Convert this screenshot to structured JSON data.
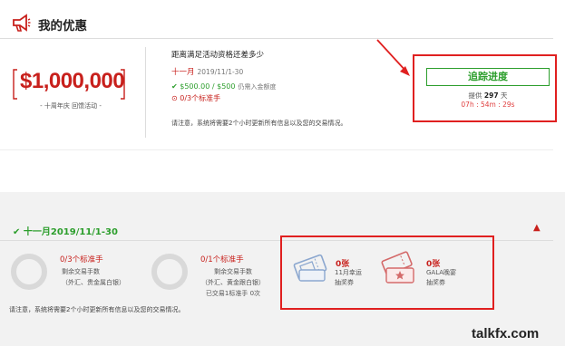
{
  "header": {
    "title": "我的优惠"
  },
  "promo": {
    "amount": "$1,000,000",
    "subtitle": "- 十周年庆 回馈活动 -"
  },
  "detail": {
    "question": "距离满足活动资格还差多少",
    "month": "十一月",
    "date_range": "2019/11/1-30",
    "amount_progress": "$500.00 / $500",
    "amount_note": "仍需入金额度",
    "lots_progress": "0/3个标准手",
    "notice": "请注意，系统将需要2个小时更新所有信息以及您的交易情况。"
  },
  "tracking": {
    "button_label": "追踪进度",
    "remain_prefix": "提供",
    "remain_days": "297",
    "remain_suffix": "天",
    "countdown": "07h : 54m : 29s"
  },
  "section": {
    "title": "十一月2019/11/1-30",
    "lots1_title": "0/3个标准手",
    "lots1_line1": "剩余交易手数",
    "lots1_line2": "（外汇、贵金属白银）",
    "lots2_title": "0/1个标准手",
    "lots2_line1": "剩余交易手数",
    "lots2_line2": "（外汇、黄金跟白银）",
    "lots2_line3": "已交易1标准手 0次",
    "ticket1_count": "0张",
    "ticket1_line1": "11月幸运",
    "ticket1_line2": "抽奖券",
    "ticket2_count": "0张",
    "ticket2_line1": "GALA晚宴",
    "ticket2_line2": "抽奖券",
    "notice": "请注意，系统将需要2个小时更新所有信息以及您的交易情况。"
  },
  "watermark": "talkfx.com",
  "colors": {
    "accent_red": "#c8201c",
    "accent_green": "#2c9e2c",
    "highlight_red": "#e02020"
  },
  "icons": [
    "megaphone-icon",
    "check-icon",
    "clock-icon",
    "chevron-up-icon",
    "ticket-icon",
    "ticket-stamp-icon"
  ]
}
